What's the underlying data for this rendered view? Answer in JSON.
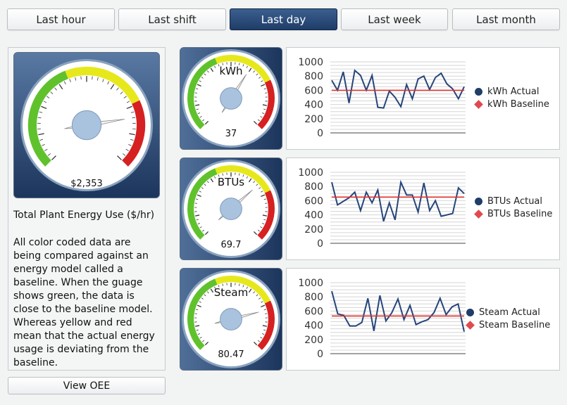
{
  "colors": {
    "accent": "#1f3d68",
    "series_line": "#26457a",
    "baseline_line": "#e0302c",
    "legend_actual": "#1f3d68",
    "legend_baseline": "#e04a4f",
    "gauge_green": "#5fc22c",
    "gauge_yellow": "#e7e81c",
    "gauge_red": "#d52121"
  },
  "tabs": [
    {
      "label": "Last hour",
      "active": false
    },
    {
      "label": "Last shift",
      "active": false
    },
    {
      "label": "Last day",
      "active": true
    },
    {
      "label": "Last week",
      "active": false
    },
    {
      "label": "Last month",
      "active": false
    }
  ],
  "left_panel": {
    "gauge_value": "$2,353",
    "gauge_needle_fraction": 0.8,
    "title": "Total Plant Energy Use ($/hr)",
    "description": "All color coded data are being compared against an energy model called a baseline. When the guage shows green, the data is close to the baseline model. Whereas yellow and red mean that the actual energy usage is deviating from the baseline.",
    "button_label": "View OEE"
  },
  "gauges": [
    {
      "label": "kWh",
      "value": "37",
      "needle_fraction": 0.62
    },
    {
      "label": "BTUs",
      "value": "69.7",
      "needle_fraction": 0.68
    },
    {
      "label": "Steam",
      "value": "80.47",
      "needle_fraction": 0.78
    }
  ],
  "chart_data": [
    {
      "type": "line",
      "ylim": [
        0,
        1000
      ],
      "yticks": [
        0,
        200,
        400,
        600,
        800,
        1000
      ],
      "grid": true,
      "legend_position": "right",
      "series": [
        {
          "name": "kWh Actual",
          "values": [
            740,
            600,
            860,
            420,
            880,
            810,
            600,
            810,
            360,
            350,
            590,
            500,
            370,
            680,
            480,
            760,
            800,
            610,
            780,
            840,
            690,
            620,
            480,
            650
          ]
        },
        {
          "name": "kWh Baseline",
          "values": [
            600,
            600,
            600,
            600,
            600,
            600,
            600,
            600,
            600,
            600,
            600,
            600,
            600,
            600,
            600,
            600,
            600,
            600,
            600,
            600,
            600,
            600,
            600,
            600
          ]
        }
      ]
    },
    {
      "type": "line",
      "ylim": [
        0,
        1000
      ],
      "yticks": [
        0,
        200,
        400,
        600,
        800,
        1000
      ],
      "grid": true,
      "legend_position": "right",
      "series": [
        {
          "name": "BTUs Actual",
          "values": [
            860,
            540,
            590,
            640,
            720,
            460,
            720,
            570,
            750,
            310,
            570,
            330,
            860,
            680,
            680,
            440,
            850,
            460,
            600,
            380,
            400,
            420,
            780,
            700
          ]
        },
        {
          "name": "BTUs Baseline",
          "values": [
            650,
            650,
            650,
            650,
            650,
            650,
            650,
            650,
            650,
            650,
            650,
            650,
            650,
            650,
            650,
            650,
            650,
            650,
            650,
            650,
            650,
            650,
            650,
            650
          ]
        }
      ]
    },
    {
      "type": "line",
      "ylim": [
        0,
        1000
      ],
      "yticks": [
        0,
        200,
        400,
        600,
        800,
        1000
      ],
      "grid": true,
      "legend_position": "right",
      "series": [
        {
          "name": "Steam Actual",
          "values": [
            880,
            560,
            540,
            390,
            390,
            440,
            780,
            320,
            820,
            460,
            580,
            770,
            480,
            680,
            410,
            450,
            480,
            580,
            780,
            550,
            660,
            700,
            310
          ]
        },
        {
          "name": "Steam Baseline",
          "values": [
            530,
            530,
            530,
            530,
            530,
            530,
            530,
            530,
            530,
            530,
            530,
            530,
            530,
            530,
            530,
            530,
            530,
            530,
            530,
            530,
            530,
            530,
            530
          ]
        }
      ]
    }
  ]
}
